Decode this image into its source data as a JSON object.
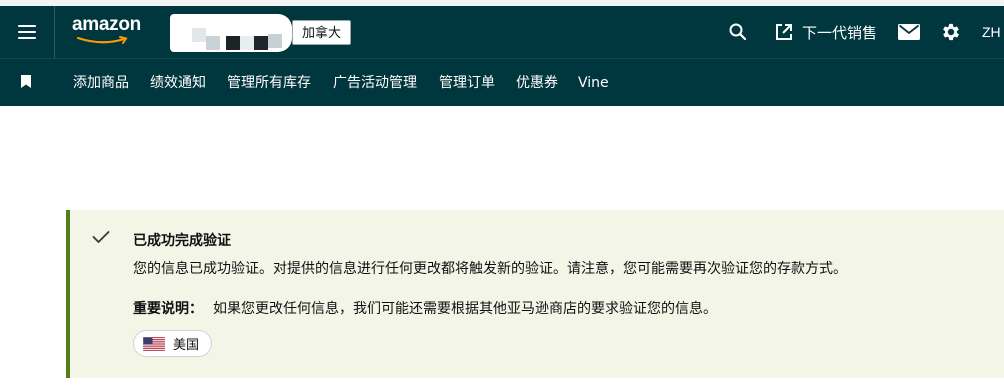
{
  "header": {
    "logo_text": "amazon",
    "marketplace": "加拿大",
    "next_gen_label": "下一代销售",
    "language": "ZH",
    "icons": [
      "menu-icon",
      "search-icon",
      "external-link-icon",
      "mail-icon",
      "gear-icon"
    ]
  },
  "nav": {
    "items": [
      {
        "label": "添加商品"
      },
      {
        "label": "绩效通知"
      },
      {
        "label": "管理所有库存"
      },
      {
        "label": "广告活动管理"
      },
      {
        "label": "管理订单"
      },
      {
        "label": "优惠券"
      },
      {
        "label": "Vine"
      }
    ]
  },
  "alert": {
    "title": "已成功完成验证",
    "body": "您的信息已成功验证。对提供的信息进行任何更改都将触发新的验证。请注意，您可能需要再次验证您的存款方式。",
    "note_label": "重要说明：",
    "note_text": "如果您更改任何信息，我们可能还需要根据其他亚马逊商店的要求验证您的信息。",
    "country": "美国",
    "status_color": "#507f1c"
  },
  "colors": {
    "header_bg": "#00363d",
    "alert_bg": "#f3f6e6"
  }
}
